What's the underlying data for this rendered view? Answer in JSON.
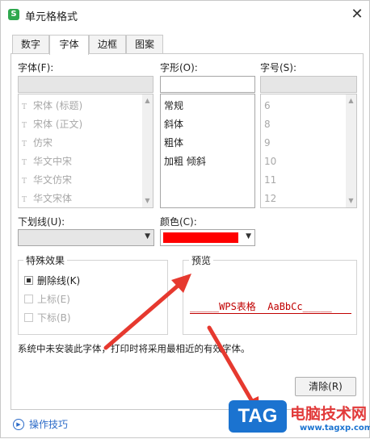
{
  "window": {
    "app_icon_letter": "S",
    "title": "单元格格式",
    "close_glyph": "✕"
  },
  "tabs": [
    {
      "label": "数字",
      "active": false
    },
    {
      "label": "字体",
      "active": true
    },
    {
      "label": "边框",
      "active": false
    },
    {
      "label": "图案",
      "active": false
    }
  ],
  "font": {
    "label": "字体(F):",
    "fonts": [
      "宋体 (标题)",
      "宋体 (正文)",
      "仿宋",
      "华文中宋",
      "华文仿宋",
      "华文宋体"
    ]
  },
  "style": {
    "label": "字形(O):",
    "options": [
      "常规",
      "斜体",
      "粗体",
      "加粗 倾斜"
    ]
  },
  "size": {
    "label": "字号(S):",
    "options": [
      "6",
      "8",
      "9",
      "10",
      "11",
      "12"
    ]
  },
  "underline": {
    "label": "下划线(U):",
    "value": ""
  },
  "color": {
    "label": "颜色(C):",
    "value": "#ff0000"
  },
  "effects": {
    "title": "特殊效果",
    "strikethrough": {
      "label": "删除线(K)",
      "checked": true
    },
    "superscript": {
      "label": "上标(E)",
      "checked": false
    },
    "subscript": {
      "label": "下标(B)",
      "checked": false
    }
  },
  "preview": {
    "title": "预览",
    "sample": "_____WPS表格  AaBbCc_____"
  },
  "note": "系统中未安装此字体，打印时将采用最相近的有效字体。",
  "buttons": {
    "clear": "清除(R)"
  },
  "footer": {
    "tip": "操作技巧"
  },
  "watermark": {
    "tag": "TAG",
    "site": "电脑技术网",
    "url": "www.tagxp.com"
  },
  "colors": {
    "accent_red": "#ff0000",
    "link_blue": "#2c6bc8",
    "arrow_red": "#e6392f"
  }
}
